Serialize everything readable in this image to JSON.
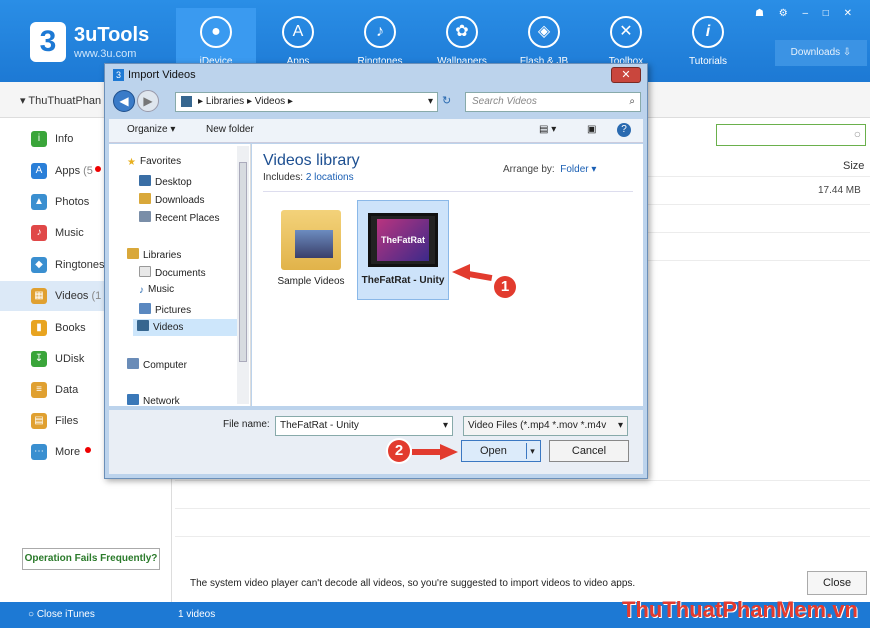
{
  "app": {
    "brand": "3uTools",
    "url": "www.3u.com",
    "logo": "3"
  },
  "nav": [
    {
      "label": "iDevice",
      "icon": "apple-icon",
      "glyph": ""
    },
    {
      "label": "Apps",
      "icon": "apps-icon",
      "glyph": "A"
    },
    {
      "label": "Ringtones",
      "icon": "bell-icon",
      "glyph": "♪"
    },
    {
      "label": "Wallpapers",
      "icon": "flower-icon",
      "glyph": "✿"
    },
    {
      "label": "Flash & JB",
      "icon": "box-icon",
      "glyph": "◈"
    },
    {
      "label": "Toolbox",
      "icon": "tools-icon",
      "glyph": "✕"
    },
    {
      "label": "Tutorials",
      "icon": "info-icon",
      "glyph": "i"
    }
  ],
  "downloads_label": "Downloads",
  "device_name": "ThuThuatPhan",
  "sidebar": [
    {
      "label": "Info",
      "count": "",
      "color": "#3aa53a",
      "glyph": "i"
    },
    {
      "label": "Apps",
      "count": "(5",
      "color": "#2a7fd8",
      "glyph": "A"
    },
    {
      "label": "Photos",
      "count": "",
      "color": "#3a8fd0",
      "glyph": "▲"
    },
    {
      "label": "Music",
      "count": "",
      "color": "#e04848",
      "glyph": "♪"
    },
    {
      "label": "Ringtones",
      "count": "",
      "color": "#3a8fd0",
      "glyph": "◆"
    },
    {
      "label": "Videos",
      "count": "(1",
      "color": "#e0a030",
      "glyph": "▦"
    },
    {
      "label": "Books",
      "count": "",
      "color": "#e8a420",
      "glyph": "▮"
    },
    {
      "label": "UDisk",
      "count": "",
      "color": "#3aa53a",
      "glyph": "↧"
    },
    {
      "label": "Data",
      "count": "",
      "color": "#e0a030",
      "glyph": "≡"
    },
    {
      "label": "Files",
      "count": "",
      "color": "#e0a030",
      "glyph": "▤"
    },
    {
      "label": "More",
      "count": "",
      "color": "#3a8fd0",
      "glyph": "⋯"
    }
  ],
  "operation_fails": "Operation Fails Frequently?",
  "size_header": "Size",
  "size_value": "17.44 MB",
  "notice": "The system video player can't decode all videos, so you're suggested to import videos to video apps.",
  "close_label": "Close",
  "status": {
    "close_itunes": "Close iTunes",
    "count": "1 videos"
  },
  "watermark": "ThuThuatPhanMem.vn",
  "dialog": {
    "title": "Import Videos",
    "address": [
      "Libraries",
      "Videos"
    ],
    "search_placeholder": "Search Videos",
    "organize": "Organize ▾",
    "new_folder": "New folder",
    "favorites": "Favorites",
    "fav_items": [
      "Desktop",
      "Downloads",
      "Recent Places"
    ],
    "libraries": "Libraries",
    "lib_items": [
      "Documents",
      "Music",
      "Pictures",
      "Videos"
    ],
    "computer": "Computer",
    "network": "Network",
    "lib_title": "Videos library",
    "includes_label": "Includes:",
    "includes_link": "2 locations",
    "arrange_label": "Arrange by:",
    "arrange_value": "Folder ▾",
    "tiles": [
      {
        "label": "Sample Videos"
      },
      {
        "label": "TheFatRat - Unity",
        "thumb_text": "TheFatRat"
      }
    ],
    "filename_label": "File name:",
    "filename_value": "TheFatRat - Unity",
    "filetype": "Video Files (*.mp4 *.mov *.m4v",
    "open": "Open",
    "cancel": "Cancel"
  },
  "annotations": [
    "1",
    "2"
  ]
}
